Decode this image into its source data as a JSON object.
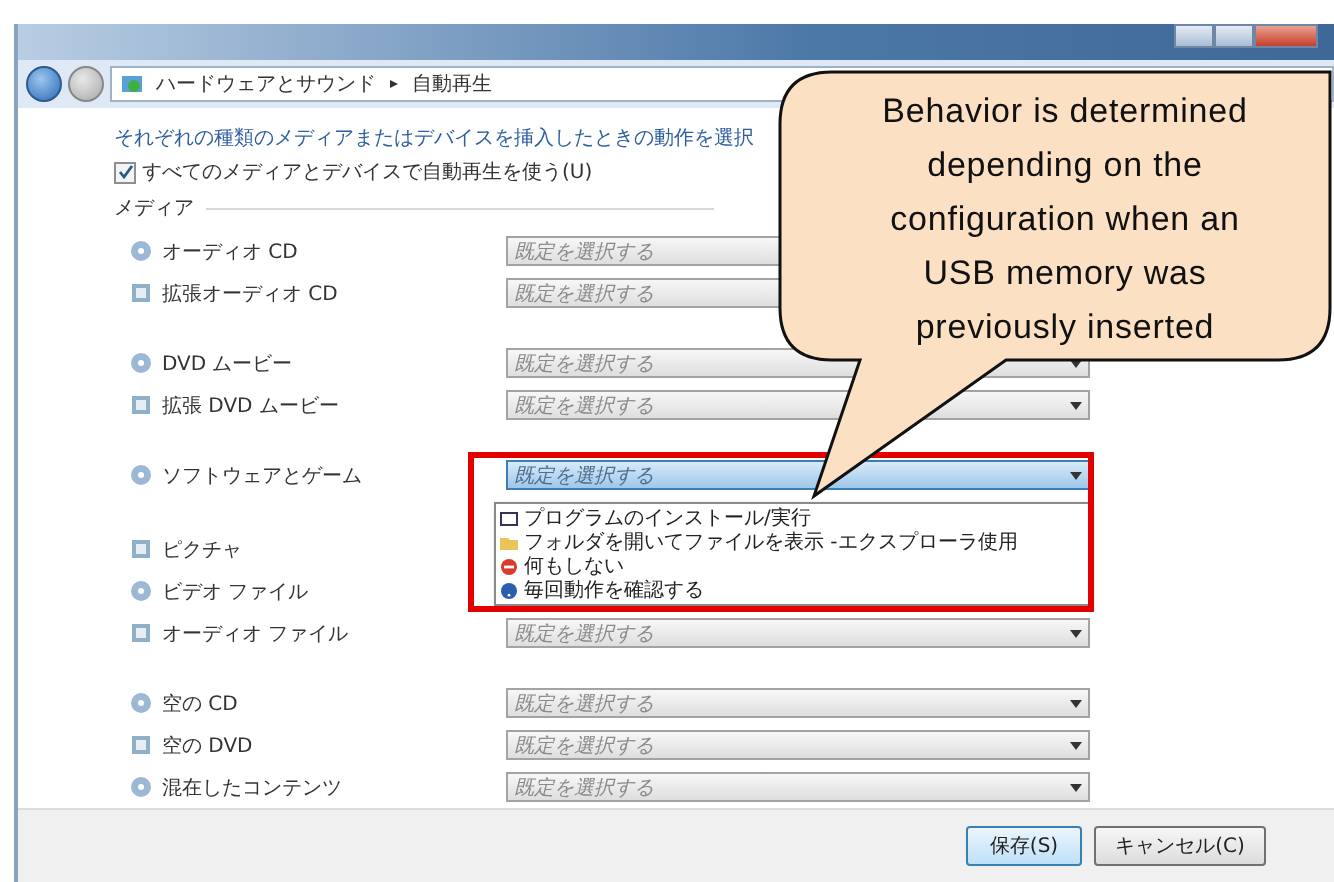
{
  "breadcrumb": {
    "parts": [
      "ハードウェアとサウンド",
      "自動再生"
    ]
  },
  "intro": "それぞれの種類のメディアまたはデバイスを挿入したときの動作を選択",
  "autoplay_all": {
    "label": "すべてのメディアとデバイスで自動再生を使う(U)",
    "checked": true
  },
  "section": "メディア",
  "groups": [
    [
      {
        "label": "オーディオ CD",
        "value": "既定を選択する"
      },
      {
        "label": "拡張オーディオ CD",
        "value": "既定を選択する"
      }
    ],
    [
      {
        "label": "DVD ムービー",
        "value": "既定を選択する"
      },
      {
        "label": "拡張 DVD ムービー",
        "value": "既定を選択する"
      }
    ],
    [
      {
        "label": "ソフトウェアとゲーム",
        "value": "既定を選択する",
        "expanded": true,
        "options": [
          {
            "kind": "program",
            "text": "プログラムのインストール/実行"
          },
          {
            "kind": "folder",
            "text": "フォルダを開いてファイルを表示 -エクスプローラ使用"
          },
          {
            "kind": "none",
            "text": "何もしない"
          },
          {
            "kind": "ask",
            "text": "毎回動作を確認する"
          }
        ]
      },
      {
        "label": "ピクチャ"
      },
      {
        "label": "ビデオ ファイル"
      },
      {
        "label": "オーディオ ファイル",
        "value": "既定を選択する"
      }
    ],
    [
      {
        "label": "空の CD",
        "value": "既定を選択する"
      },
      {
        "label": "空の DVD",
        "value": "既定を選択する"
      },
      {
        "label": "混在したコンテンツ",
        "value": "既定を選択する"
      }
    ]
  ],
  "buttons": [
    "保存(S)",
    "キャンセル(C)"
  ],
  "callout": "Behavior is determined depending on the configuration when an USB memory was previously inserted"
}
